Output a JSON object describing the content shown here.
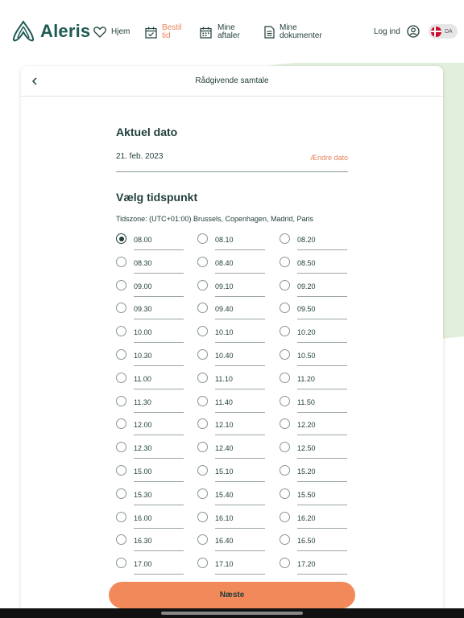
{
  "brand": {
    "name": "Aleris"
  },
  "nav": {
    "home": "Hjem",
    "book_line1": "Bestil",
    "book_line2": "tid",
    "appointments_line1": "Mine",
    "appointments_line2": "aftaler",
    "documents_line1": "Mine",
    "documents_line2": "dokumenter",
    "login": "Log ind",
    "language": "DA"
  },
  "colors": {
    "accent": "#e8835a",
    "primary_text": "#1f3d3a",
    "button": "#f2895a",
    "background_blob": "#e2efdd"
  },
  "card": {
    "title": "Rådgivende samtale",
    "current_date_heading": "Aktuel dato",
    "date_value": "21. feb. 2023",
    "change_date": "Ændre dato",
    "choose_time_heading": "Vælg tidspunkt",
    "timezone": "Tidszone: (UTC+01:00) Brussels, Copenhagen, Madrid, Paris"
  },
  "slots": [
    [
      "08.00",
      "08.10",
      "08.20"
    ],
    [
      "08.30",
      "08.40",
      "08.50"
    ],
    [
      "09.00",
      "09.10",
      "09.20"
    ],
    [
      "09.30",
      "09.40",
      "09.50"
    ],
    [
      "10.00",
      "10.10",
      "10.20"
    ],
    [
      "10.30",
      "10.40",
      "10.50"
    ],
    [
      "11.00",
      "11.10",
      "11.20"
    ],
    [
      "11.30",
      "11.40",
      "11.50"
    ],
    [
      "12.00",
      "12.10",
      "12.20"
    ],
    [
      "12.30",
      "12.40",
      "12.50"
    ],
    [
      "15.00",
      "15.10",
      "15.20"
    ],
    [
      "15.30",
      "15.40",
      "15.50"
    ],
    [
      "16.00",
      "16.10",
      "16.20"
    ],
    [
      "16.30",
      "16.40",
      "16.50"
    ],
    [
      "17.00",
      "17.10",
      "17.20"
    ]
  ],
  "selected_slot": "08.00",
  "next_button": "Næste"
}
